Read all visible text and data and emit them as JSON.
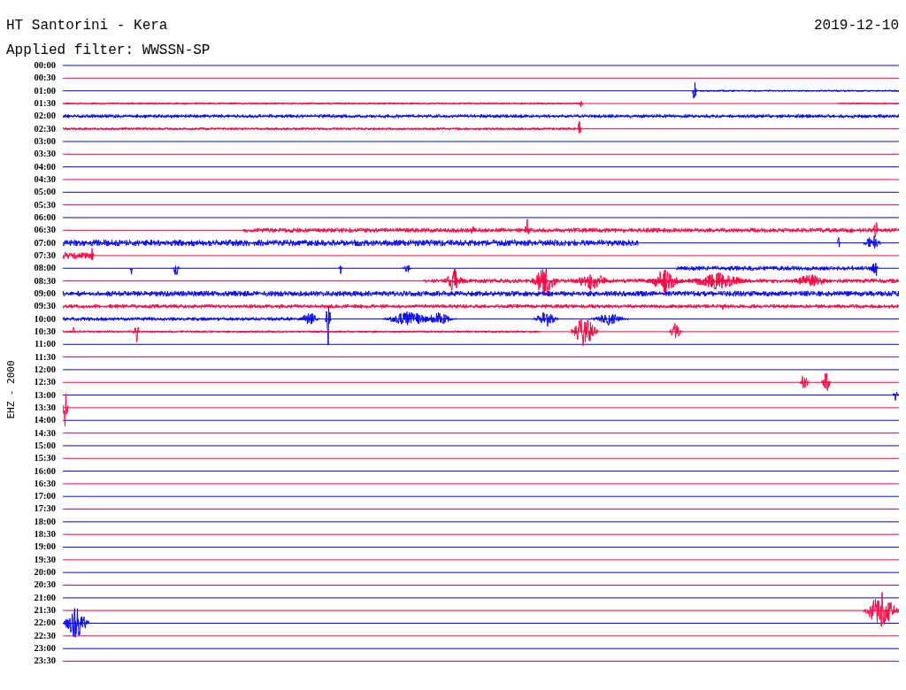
{
  "header": {
    "station": "HT Santorini - Kera",
    "date": "2019-12-10",
    "filter": "Applied filter: WWSSN-SP"
  },
  "channel_label": "EHZ - 2000",
  "time_labels": [
    "00:00",
    "00:30",
    "01:00",
    "01:30",
    "02:00",
    "02:30",
    "03:00",
    "03:30",
    "04:00",
    "04:30",
    "05:00",
    "05:30",
    "06:00",
    "06:30",
    "07:00",
    "07:30",
    "08:00",
    "08:30",
    "09:00",
    "09:30",
    "10:00",
    "10:30",
    "11:00",
    "11:30",
    "12:00",
    "12:30",
    "13:00",
    "13:30",
    "14:00",
    "14:30",
    "15:00",
    "15:30",
    "16:00",
    "16:30",
    "17:00",
    "17:30",
    "18:00",
    "18:30",
    "19:00",
    "19:30",
    "20:00",
    "20:30",
    "21:00",
    "21:30",
    "22:00",
    "22:30",
    "23:00",
    "23:30"
  ]
}
